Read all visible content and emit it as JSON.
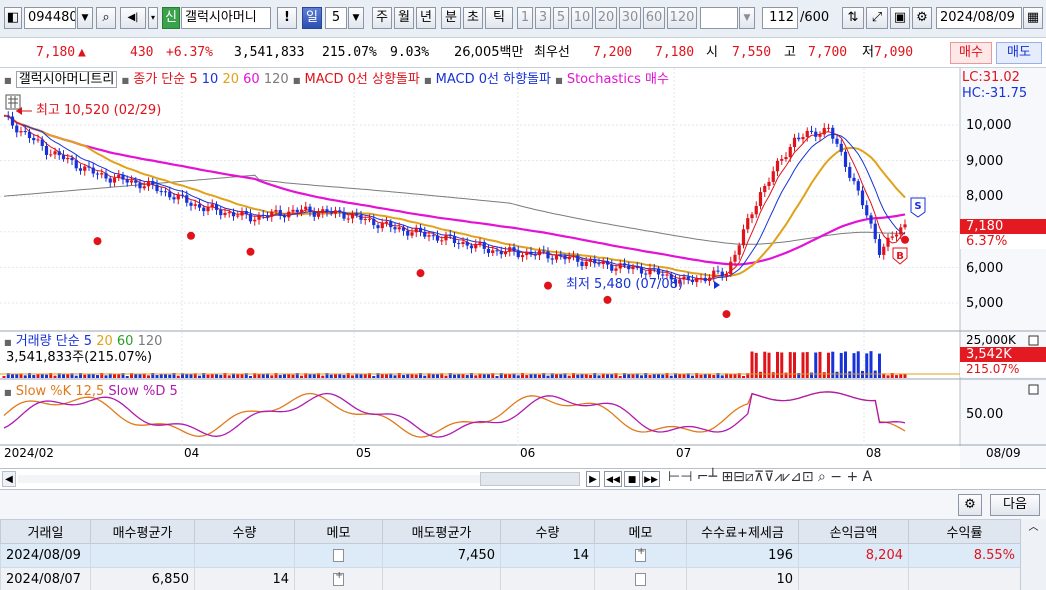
{
  "toolbar": {
    "stock_code": "094480",
    "stock_name_badge": "신",
    "stock_name": "갤럭시아머니",
    "alert_button": "!",
    "period_active": "일",
    "period_count": "5",
    "periods": [
      "주",
      "월",
      "년",
      "분",
      "초",
      "틱"
    ],
    "minute_options": [
      "1",
      "3",
      "5",
      "10",
      "20",
      "30",
      "60",
      "120"
    ],
    "range_value": "112",
    "range_total": "/600",
    "date": "2024/08/09"
  },
  "quote": {
    "price": "7,180",
    "arrow": "▲",
    "change": "430",
    "change_pct": "+6.37%",
    "volume": "3,541,833",
    "volume_ratio": "215.07%",
    "turnover": "9.03%",
    "amount": "26,005백만",
    "best_ask_label": "최우선",
    "best_ask": "7,200",
    "best_bid": "7,180",
    "open_label": "시",
    "open": "7,550",
    "high_label": "고",
    "high": "7,700",
    "low_label": "저",
    "low": "7,090",
    "buy_button": "매수",
    "sell_button": "매도"
  },
  "price_panel": {
    "legend_name": "갤럭시아머니트리",
    "legend_ma": "종가 단순",
    "legend_ma_periods": [
      "5",
      "10",
      "20",
      "60",
      "120"
    ],
    "legend_ma_colors": [
      "#e0131b",
      "#1732d8",
      "#e0a21a",
      "#e312d6",
      "#7b7b7b"
    ],
    "legend_signal1": "MACD 0선 상향돌파",
    "legend_signal2": "MACD 0선 하향돌파",
    "legend_signal3": "Stochastics 매수",
    "lc": "LC:31.02",
    "hc": "HC:-31.75",
    "high_annotation": "최고 10,520 (02/29)",
    "low_annotation": "최저 5,480 (07/08)",
    "y_ticks": [
      "10,000",
      "9,000",
      "8,000",
      "6,000",
      "5,000"
    ],
    "price_label": "7,180",
    "pct_label": "6.37%",
    "sell_marker": "S",
    "buy_marker": "B"
  },
  "volume_panel": {
    "legend_name": "거래량",
    "legend_ma": "단순",
    "legend_periods": [
      "5",
      "20",
      "60",
      "120"
    ],
    "legend_period_colors": [
      "#1732d8",
      "#e0a21a",
      "#2a9d2a",
      "#7b7b7b"
    ],
    "current": "3,541,833주(215.07%)",
    "y_tick": "25,000K",
    "value_label": "3,542K",
    "pct_label": "215.07%"
  },
  "stoch_panel": {
    "legend_k": "Slow %K 12,5",
    "legend_d": "Slow %D 5",
    "y_tick": "50.00"
  },
  "x_axis": {
    "labels": [
      "2024/02",
      "04",
      "05",
      "06",
      "07",
      "08"
    ],
    "right_label": "08/09"
  },
  "bottom": {
    "next_button": "다음",
    "columns": [
      "거래일",
      "매수평균가",
      "수량",
      "메모",
      "매도평균가",
      "수량",
      "메모",
      "수수료+제세금",
      "손익금액",
      "수익률"
    ],
    "rows": [
      {
        "date": "2024/08/09",
        "buy_avg": "",
        "buy_qty": "",
        "sell_avg": "7,450",
        "sell_qty": "14",
        "fee": "196",
        "pnl": "8,204",
        "rate": "8.55%"
      },
      {
        "date": "2024/08/07",
        "buy_avg": "6,850",
        "buy_qty": "14",
        "sell_avg": "",
        "sell_qty": "",
        "fee": "10",
        "pnl": "",
        "rate": ""
      }
    ]
  },
  "colors": {
    "up": "#e0131b",
    "down": "#1732d8",
    "ma5": "#e0131b",
    "ma10": "#1732d8",
    "ma20": "#e0a21a",
    "ma60": "#e312d6",
    "ma120": "#7b7b7b"
  }
}
